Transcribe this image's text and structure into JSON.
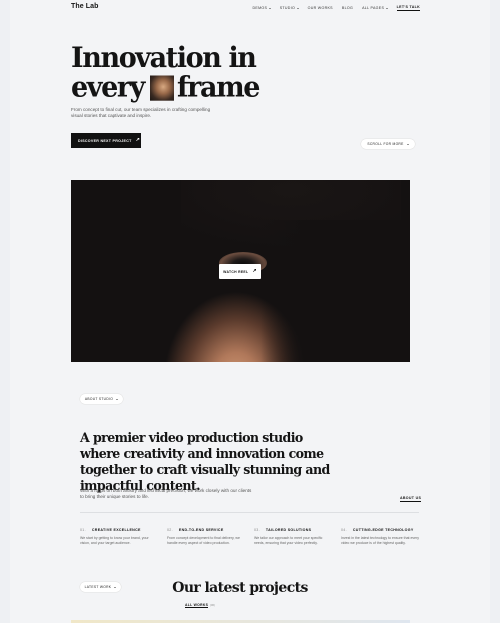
{
  "header": {
    "logo": "The Lab",
    "nav": [
      {
        "label": "DEMOS",
        "dropdown": true
      },
      {
        "label": "STUDIO",
        "dropdown": true
      },
      {
        "label": "OUR WORKS",
        "dropdown": false
      },
      {
        "label": "BLOG",
        "dropdown": false
      },
      {
        "label": "ALL PAGES",
        "dropdown": true
      },
      {
        "label": "LET'S TALK",
        "dropdown": false,
        "active": true
      }
    ]
  },
  "hero": {
    "title_line1": "Innovation in",
    "title_line2_a": "every",
    "title_line2_b": "frame",
    "description": "From concept to final cut, our team specializes in crafting compelling visual stories that captivate and inspire.",
    "discover_label": "DISCOVER NEXT PROJECT",
    "scroll_label": "SCROLL FOR MORE"
  },
  "video": {
    "watch_label": "WATCH REEL"
  },
  "about": {
    "pill_label": "ABOUT STUDIO",
    "title": "A premier video production studio where creativity and innovation come together to craft visually stunning and impactful content.",
    "description": "With a focus on both artistry and technical precision, we work closely with our clients to bring their unique stories to life.",
    "link_label": "ABOUT US"
  },
  "features": [
    {
      "num": "01.",
      "title": "CREATIVE EXCELLENCE",
      "text": "We start by getting to know your brand, your vision, and your target audience."
    },
    {
      "num": "02.",
      "title": "END-TO-END SERVICE",
      "text": "From concept development to final delivery, we handle every aspect of video production."
    },
    {
      "num": "03.",
      "title": "TAILORED SOLUTIONS",
      "text": "We tailor our approach to meet your specific needs, ensuring that your video perfectly."
    },
    {
      "num": "04.",
      "title": "CUTTING-EDGE TECHNOLOGY",
      "text": "Invest in the latest technology to ensure that every video we produce is of the highest quality."
    }
  ],
  "latest": {
    "pill_label": "LATEST WORK",
    "title": "Our latest projects",
    "tab_label": "ALL WORKS",
    "tab_count": "(06)"
  },
  "colors": {
    "background": "#f3f4f6",
    "primary_button": "#111111",
    "text": "#141414"
  }
}
